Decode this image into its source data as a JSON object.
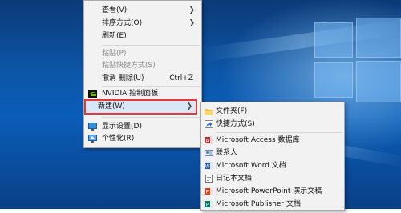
{
  "context_menu": {
    "items": [
      {
        "label": "查看(V)",
        "submenu": true
      },
      {
        "label": "排序方式(O)",
        "submenu": true
      },
      {
        "label": "刷新(E)"
      },
      {
        "label": "粘贴(P)",
        "disabled": true
      },
      {
        "label": "粘贴快捷方式(S)",
        "disabled": true
      },
      {
        "label": "撤消 删除(U)",
        "shortcut": "Ctrl+Z"
      },
      {
        "label": "NVIDIA 控制面板",
        "icon": "nvidia-icon"
      },
      {
        "label": "新建(W)",
        "submenu": true,
        "highlighted": true
      },
      {
        "label": "显示设置(D)",
        "icon": "display-settings-icon"
      },
      {
        "label": "个性化(R)",
        "icon": "personalize-icon"
      }
    ]
  },
  "new_submenu": {
    "items": [
      {
        "label": "文件夹(F)",
        "icon": "folder-icon"
      },
      {
        "label": "快捷方式(S)",
        "icon": "shortcut-icon"
      },
      {
        "label": "Microsoft Access 数据库",
        "icon": "access-icon"
      },
      {
        "label": "联系人",
        "icon": "contact-icon"
      },
      {
        "label": "Microsoft Word 文档",
        "icon": "word-icon"
      },
      {
        "label": "日记本文档",
        "icon": "journal-icon"
      },
      {
        "label": "Microsoft PowerPoint 演示文稿",
        "icon": "powerpoint-icon"
      },
      {
        "label": "Microsoft Publisher 文档",
        "icon": "publisher-icon"
      }
    ]
  },
  "colors": {
    "highlight_border": "#e03a3a",
    "menu_bg": "#f2f2f2"
  }
}
